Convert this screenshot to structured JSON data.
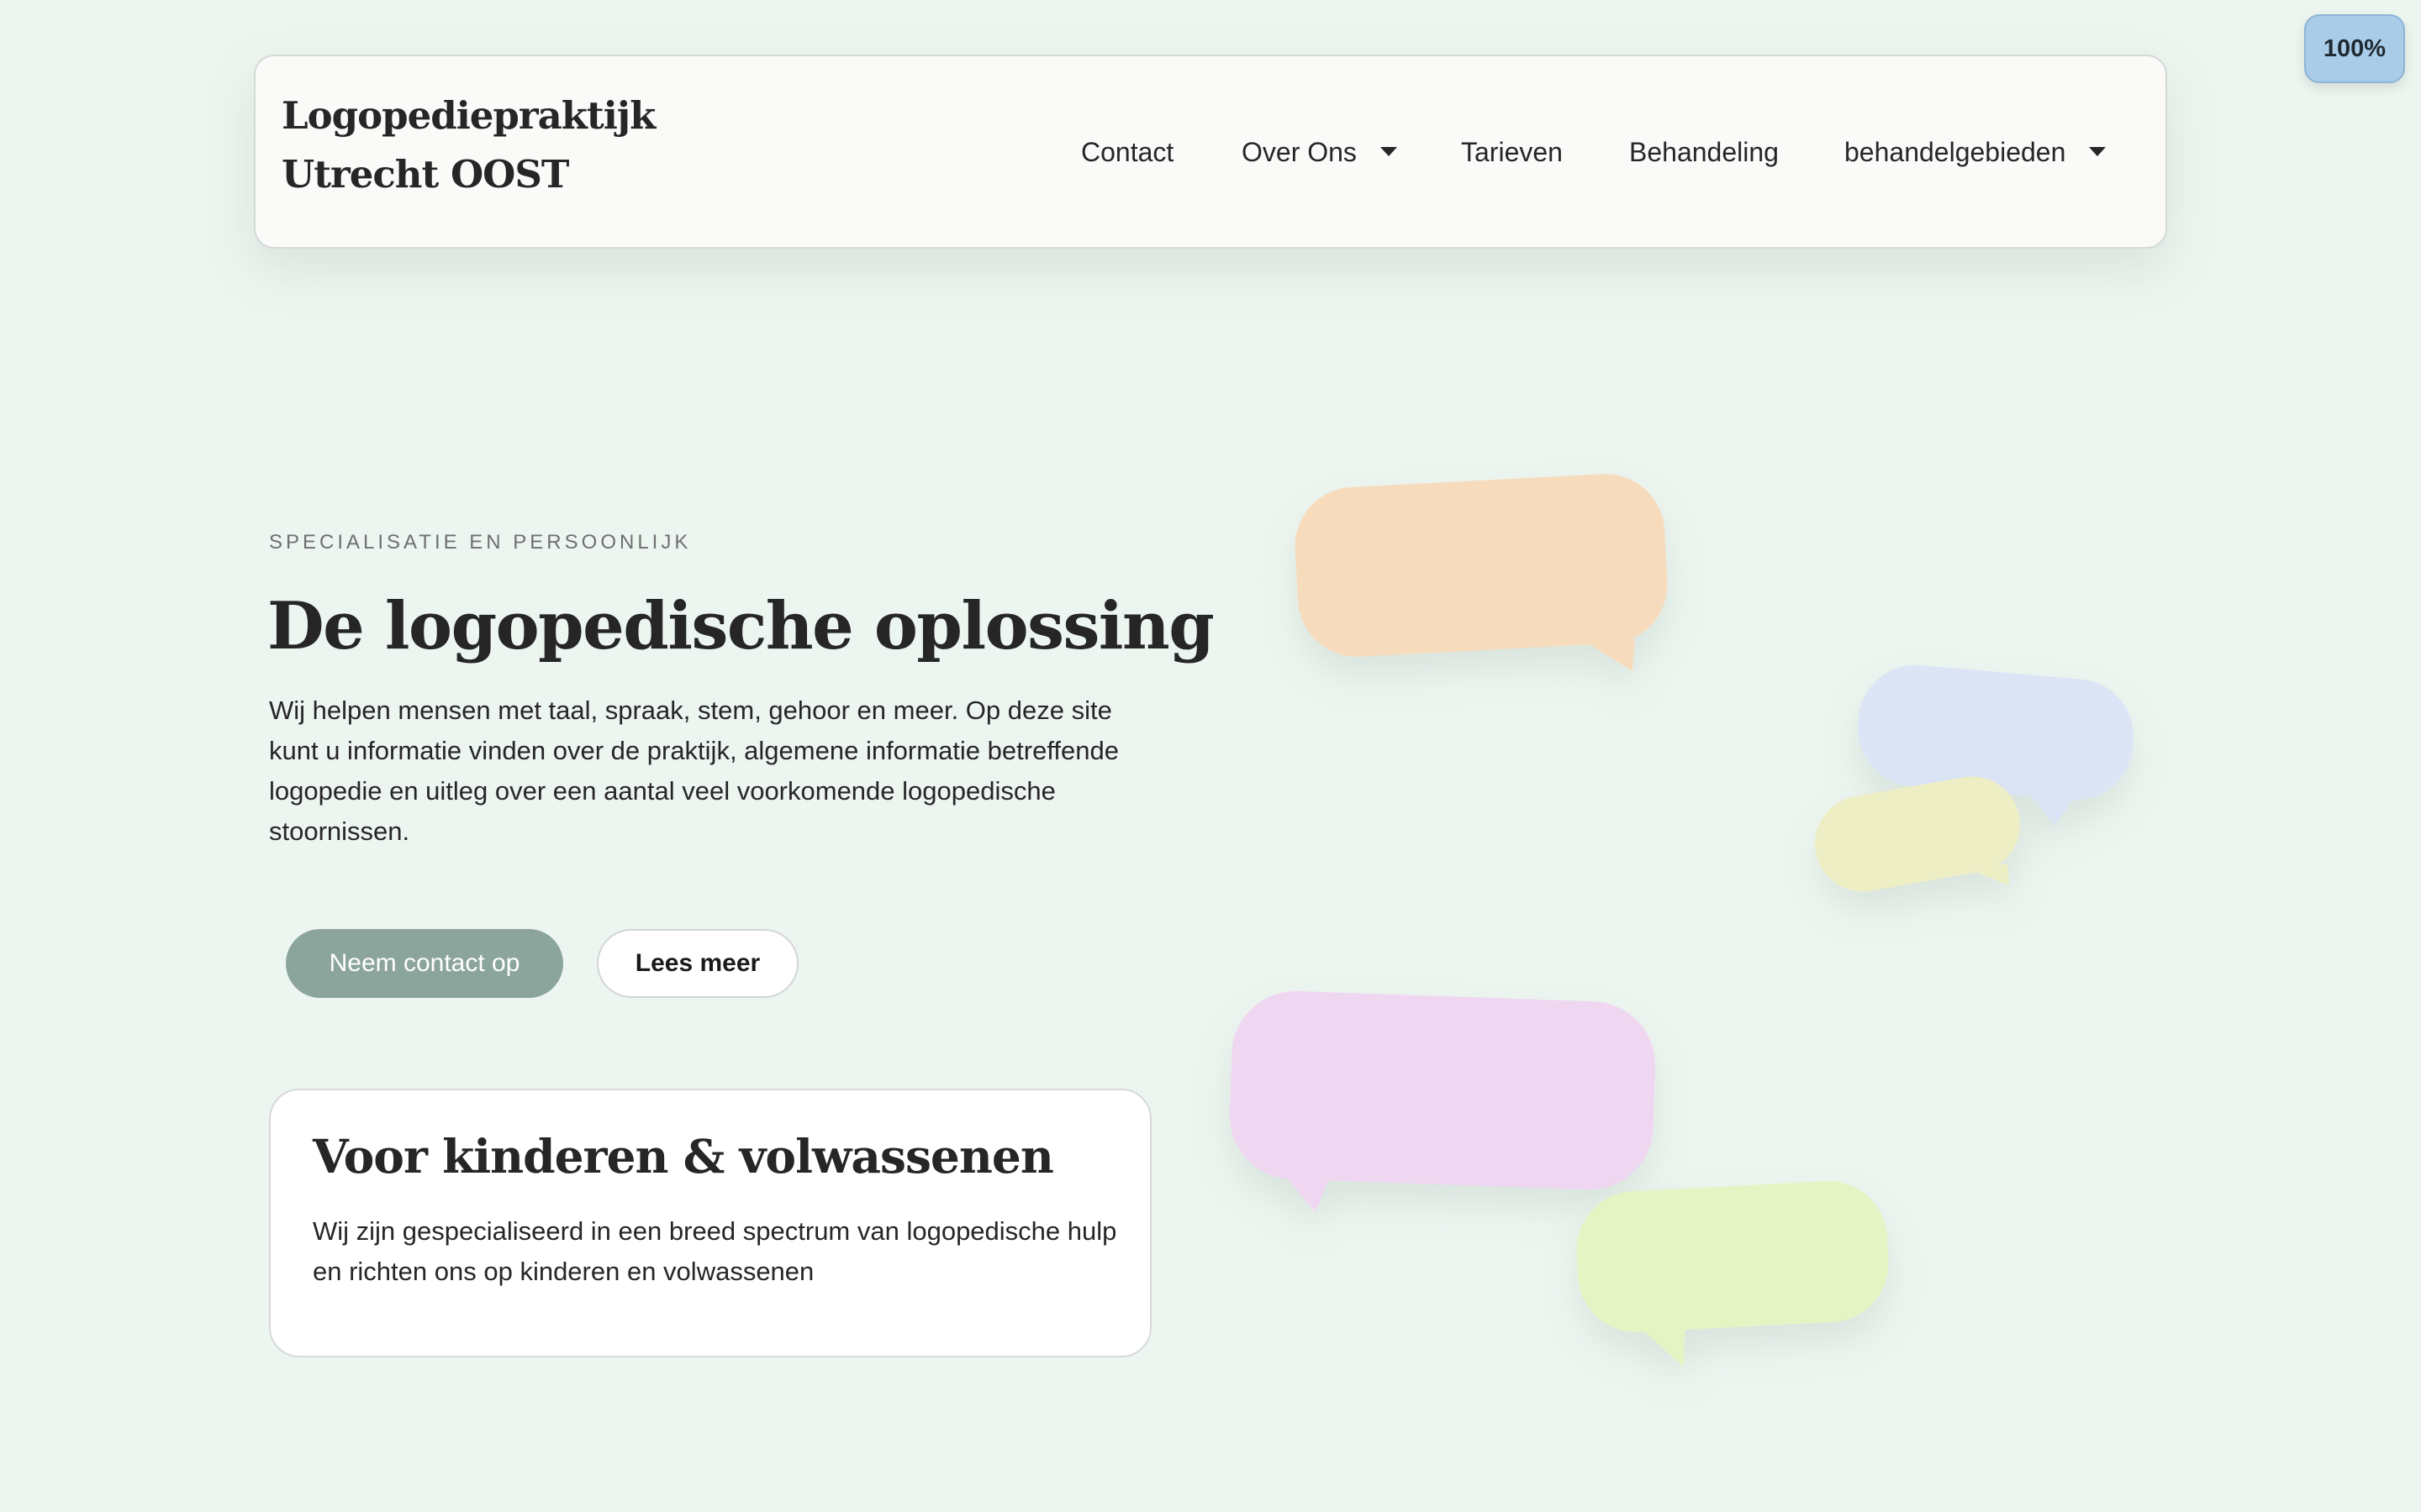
{
  "header": {
    "brand_line1": "Logopediepraktijk",
    "brand_line2": "Utrecht OOST",
    "nav": {
      "contact": "Contact",
      "over_ons": "Over Ons",
      "tarieven": "Tarieven",
      "behandeling": "Behandeling",
      "behandelgebieden": "behandelgebieden"
    }
  },
  "zoom": {
    "label": "100%"
  },
  "hero": {
    "eyebrow": "SPECIALISATIE EN PERSOONLIJK",
    "title": "De logopedische oplossing",
    "text": "Wij helpen mensen met taal, spraak, stem, gehoor en meer. Op deze site kunt u informatie vinden over de praktijk, algemene informatie betreffende logopedie en uitleg over een aantal veel voorkomende logopedische stoornissen.",
    "primary_button": "Neem contact op",
    "secondary_button": "Lees meer"
  },
  "card": {
    "title": "Voor kinderen & volwassenen",
    "text": "Wij zijn gespecialiseerd in een breed spectrum van logopedische hulp en richten ons op kinderen en volwassenen"
  },
  "colors": {
    "background": "#edf5f0",
    "primary_button": "#8ba49c",
    "zoom_badge": "#a9cce9",
    "bubble_orange": "#f6dcbd",
    "bubble_blue": "#dce5f5",
    "bubble_yellow": "#eeeec4",
    "bubble_pink": "#efd7f2",
    "bubble_green": "#e6f4c4"
  }
}
